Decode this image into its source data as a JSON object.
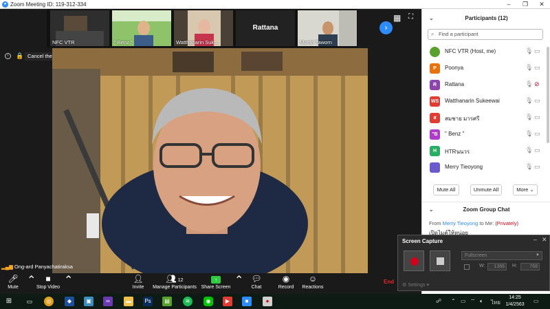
{
  "window": {
    "title": "Zoom Meeting ID: 119-312-334"
  },
  "thumbnails": [
    {
      "name": "NFC VTR"
    },
    {
      "name": "\" Benz \""
    },
    {
      "name": "Watthanarin Suk..."
    },
    {
      "name": "Rattana"
    },
    {
      "name": "Montri Taworn"
    }
  ],
  "spotlight": {
    "label": "Cancel the Spotlight Video"
  },
  "speaker": {
    "name": "Ong-ard Panyachatiraksa"
  },
  "toolbar": {
    "mute": "Mute",
    "stop_video": "Stop Video",
    "invite": "Invite",
    "manage_participants": "Manage Participants",
    "participant_count": "12",
    "share_screen": "Share Screen",
    "chat": "Chat",
    "record": "Record",
    "reactions": "Reactions",
    "end": "End"
  },
  "participants_panel": {
    "title": "Participants (12)",
    "search_placeholder": "Find a participant",
    "list": [
      {
        "initial": "",
        "name": "NFC VTR (Host, me)",
        "color": "#5aa02c",
        "mic": "on"
      },
      {
        "initial": "P",
        "name": "Poonya",
        "color": "#e8710a",
        "mic": "on"
      },
      {
        "initial": "R",
        "name": "Rattana",
        "color": "#8e44ad",
        "mic": "muted"
      },
      {
        "initial": "WS",
        "name": "Watthanarin Sukeewai",
        "color": "#e03c31",
        "mic": "on"
      },
      {
        "initial": "ส",
        "name": "สมชาย มารศรี",
        "color": "#e03c31",
        "mic": "on"
      },
      {
        "initial": "\"B",
        "name": "\" Benz \"",
        "color": "#b03ac9",
        "mic": "on"
      },
      {
        "initial": "H",
        "name": "HTRนนวร",
        "color": "#27ae60",
        "mic": "on"
      },
      {
        "initial": "",
        "name": "Merry Tieoyong",
        "color": "#6a5acd",
        "mic": "on"
      }
    ],
    "mute_all": "Mute All",
    "unmute_all": "Unmute All",
    "more": "More"
  },
  "chat_panel": {
    "title": "Zoom Group Chat",
    "msg_from": "From",
    "msg_sender": "Merry Tieoyong",
    "msg_to": "to Me:",
    "msg_private": "(Privately)",
    "msg_text": "เปิดไมค์ให้หน่อย"
  },
  "screen_capture": {
    "title": "Screen Capture",
    "mode": "Fullscreen",
    "w_label": "W:",
    "w_value": "1366",
    "h_label": "H:",
    "h_value": "768",
    "settings": "Settings"
  },
  "taskbar": {
    "lang": "ไทย",
    "time": "14:25",
    "date": "1/4/2563"
  }
}
